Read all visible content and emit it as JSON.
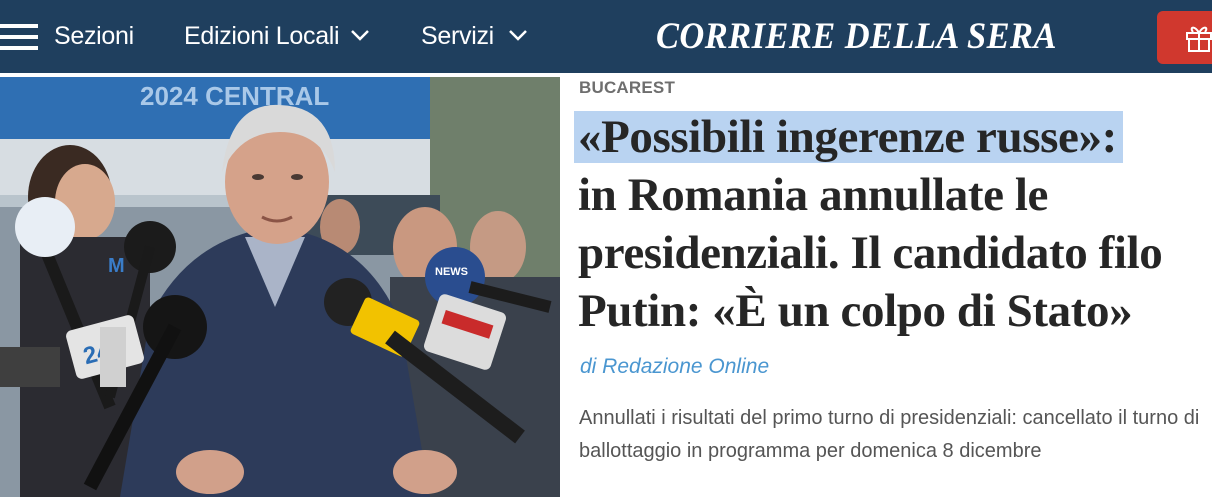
{
  "header": {
    "menu_label": "Sezioni",
    "nav": [
      {
        "label": "Edizioni Locali",
        "icon": "chevron-down-icon"
      },
      {
        "label": "Servizi",
        "icon": "chevron-down-icon"
      }
    ],
    "masthead": "CORRIERE DELLA SERA",
    "gift_icon": "gift-icon",
    "colors": {
      "bar": "#1f3f5e",
      "gift_button": "#d0382e"
    }
  },
  "photo": {
    "banner_text": "2024 CENTRAL",
    "mic_labels": [
      "24",
      "NEWS",
      "M"
    ]
  },
  "article": {
    "kicker": "BUCAREST",
    "headline_highlighted": "«Possibili ingerenze russe»:",
    "headline_rest": "in Romania annullate le presidenziali. Il candidato filo Putin: «È un colpo di Stato»",
    "byline": "di Redazione Online",
    "summary": "Annullati i risultati del primo turno di presidenziali: cancellato il turno di ballottaggio in programma per domenica 8 dicembre",
    "colors": {
      "highlight": "#b9d3f1",
      "byline": "#4a96d0"
    }
  }
}
